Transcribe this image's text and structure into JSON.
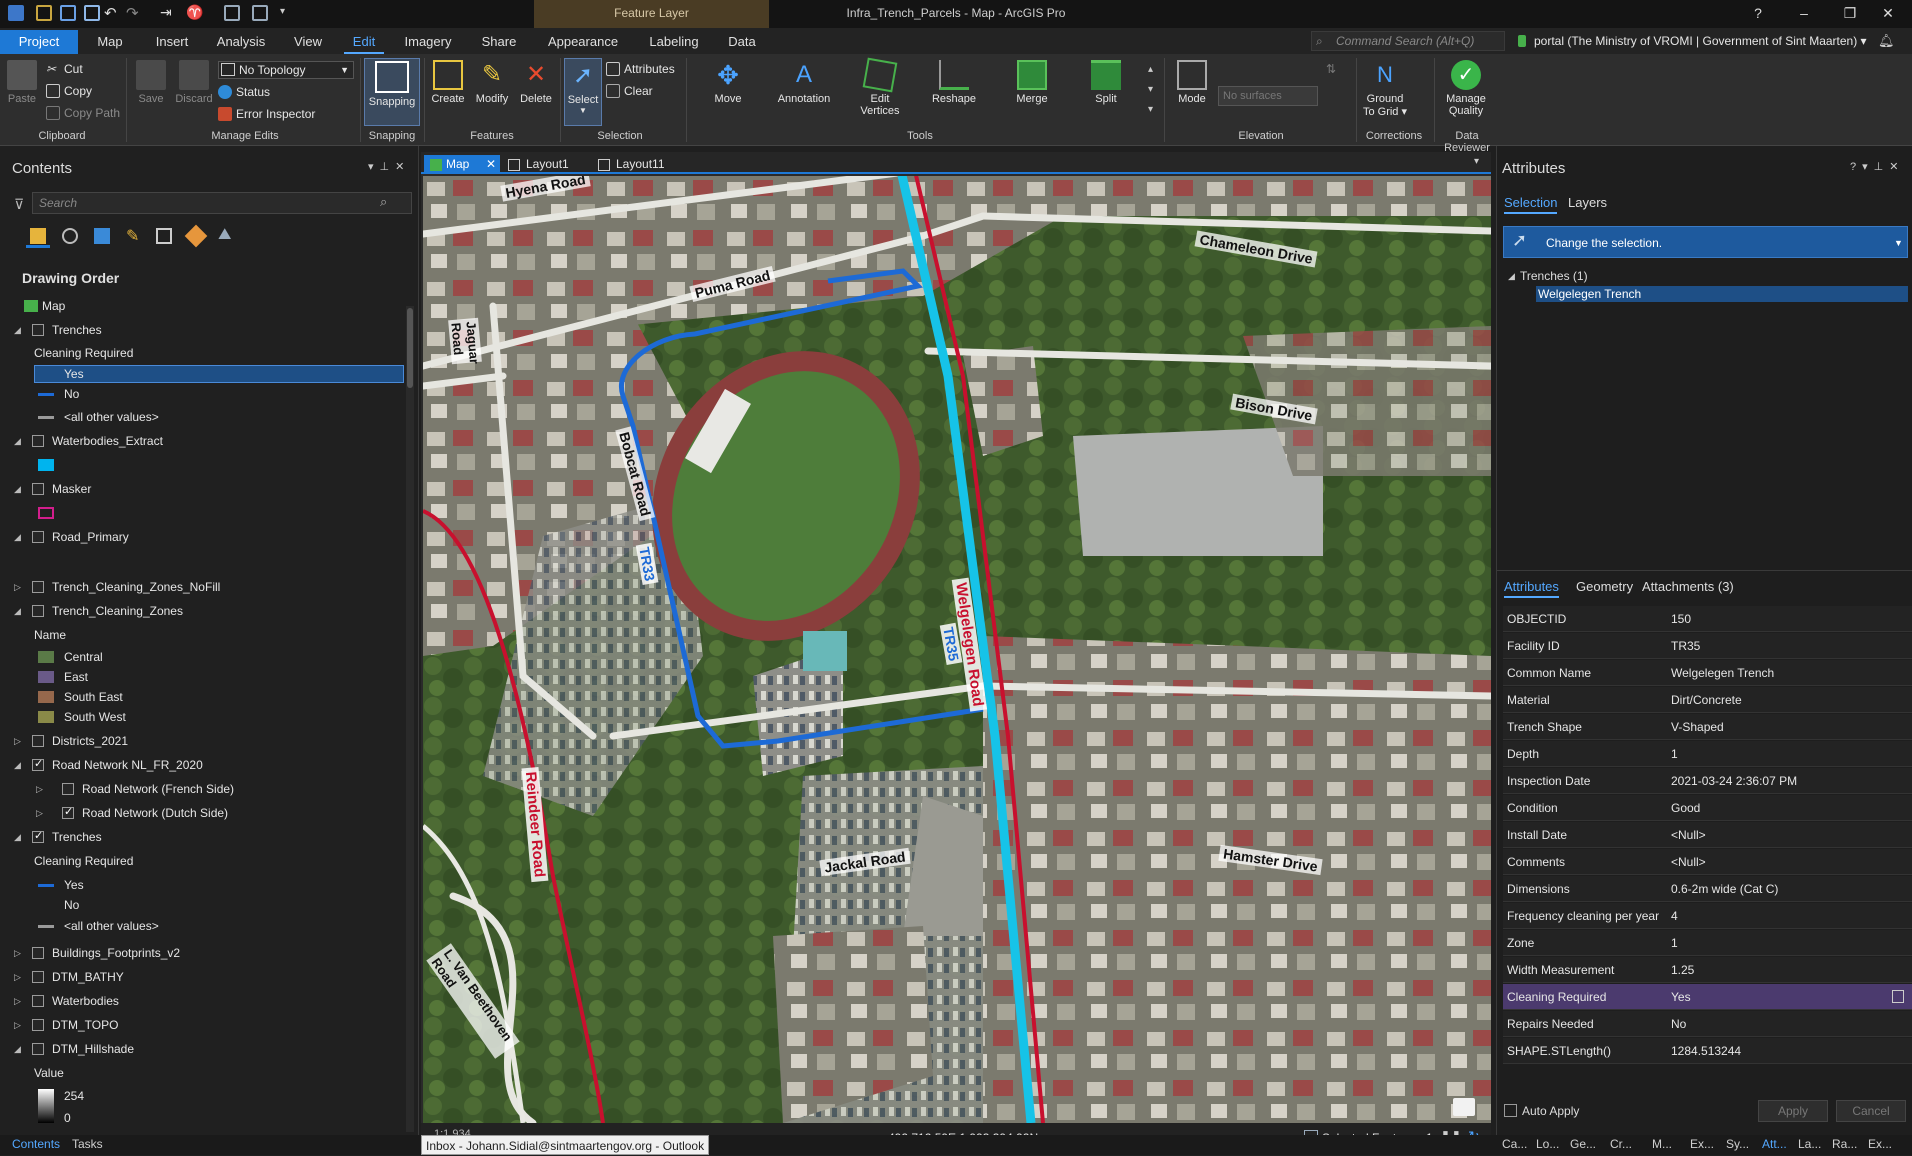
{
  "window": {
    "title": "Infra_Trench_Parcels - Map - ArcGIS Pro",
    "context_tab": "Feature Layer",
    "help": "?",
    "min": "–",
    "restore": "❐",
    "close": "✕"
  },
  "ribbon_tabs": [
    "Project",
    "Map",
    "Insert",
    "Analysis",
    "View",
    "Edit",
    "Imagery",
    "Share",
    "Appearance",
    "Labeling",
    "Data"
  ],
  "command_search": {
    "placeholder": "Command Search (Alt+Q)"
  },
  "portal": "portal (The Ministry of VROMI | Government of Sint Maarten) ▾",
  "ribbon": {
    "clipboard": {
      "paste": "Paste",
      "cut": "Cut",
      "copy": "Copy",
      "copy_path": "Copy Path",
      "group": "Clipboard"
    },
    "manage_edits": {
      "save": "Save",
      "discard": "Discard",
      "topology": "No Topology",
      "status": "Status",
      "error_inspector": "Error Inspector",
      "group": "Manage Edits"
    },
    "snapping": {
      "label": "Snapping",
      "group": "Snapping"
    },
    "features": {
      "create": "Create",
      "modify": "Modify",
      "delete": "Delete",
      "group": "Features"
    },
    "selection": {
      "select": "Select",
      "attributes": "Attributes",
      "clear": "Clear",
      "group": "Selection"
    },
    "tools": {
      "move": "Move",
      "annotation": "Annotation",
      "edit_vertices": "Edit Vertices",
      "reshape": "Reshape",
      "merge": "Merge",
      "split": "Split",
      "group": "Tools"
    },
    "elevation": {
      "mode": "Mode",
      "surfaces_placeholder": "No surfaces",
      "group": "Elevation"
    },
    "corrections": {
      "ground_to_grid": "Ground To Grid ▾",
      "group": "Corrections"
    },
    "data_reviewer": {
      "manage_quality": "Manage Quality",
      "group": "Data Reviewer"
    }
  },
  "contents": {
    "title": "Contents",
    "search_placeholder": "Search",
    "drawing_order": "Drawing Order",
    "items": [
      {
        "label": "Map",
        "level": 0,
        "type": "map"
      },
      {
        "label": "Trenches",
        "level": 1,
        "checked": false
      },
      {
        "label": "Cleaning Required",
        "level": 2,
        "type": "heading"
      },
      {
        "label": "Yes",
        "level": 2,
        "type": "legend",
        "color": "#1d6ad6",
        "selected": true
      },
      {
        "label": "No",
        "level": 2,
        "type": "legend",
        "color": "#1d6ad6"
      },
      {
        "label": "<all other values>",
        "level": 2,
        "type": "legend",
        "color": "#9a9a9a"
      },
      {
        "label": "Waterbodies_Extract",
        "level": 1,
        "checked": false
      },
      {
        "label": "",
        "level": 2,
        "type": "fill",
        "color": "#00b4ee"
      },
      {
        "label": "Masker",
        "level": 1,
        "checked": false
      },
      {
        "label": "",
        "level": 2,
        "type": "outline",
        "color": "#d21e8c"
      },
      {
        "label": "Road_Primary",
        "level": 1,
        "checked": false
      },
      {
        "label": "Trench_Cleaning_Zones_NoFill",
        "level": 1,
        "checked": false,
        "collapsed": true
      },
      {
        "label": "Trench_Cleaning_Zones",
        "level": 1,
        "checked": false
      },
      {
        "label": "Name",
        "level": 2,
        "type": "heading"
      },
      {
        "label": "Central",
        "level": 2,
        "type": "fill",
        "color": "#5a7a47"
      },
      {
        "label": "East",
        "level": 2,
        "type": "fill",
        "color": "#6a5a88"
      },
      {
        "label": "South East",
        "level": 2,
        "type": "fill",
        "color": "#96684c"
      },
      {
        "label": "South West",
        "level": 2,
        "type": "fill",
        "color": "#8a8a48"
      },
      {
        "label": "Districts_2021",
        "level": 1,
        "checked": false,
        "collapsed": true
      },
      {
        "label": "Road Network NL_FR_2020",
        "level": 1,
        "checked": true
      },
      {
        "label": "Road Network (French Side)",
        "level": 2,
        "checked": false,
        "collapsed": true
      },
      {
        "label": "Road Network (Dutch Side)",
        "level": 2,
        "checked": true,
        "collapsed": true
      },
      {
        "label": "Trenches",
        "level": 1,
        "checked": true
      },
      {
        "label": "Cleaning Required",
        "level": 2,
        "type": "heading"
      },
      {
        "label": "Yes",
        "level": 2,
        "type": "legend",
        "color": "#1d6ad6"
      },
      {
        "label": "No",
        "level": 2,
        "type": "legend",
        "color": "#202020"
      },
      {
        "label": "<all other values>",
        "level": 2,
        "type": "legend",
        "color": "#9a9a9a"
      },
      {
        "label": "Buildings_Footprints_v2",
        "level": 1,
        "checked": false,
        "collapsed": true
      },
      {
        "label": "DTM_BATHY",
        "level": 1,
        "checked": false,
        "collapsed": true
      },
      {
        "label": "Waterbodies",
        "level": 1,
        "checked": false,
        "collapsed": true
      },
      {
        "label": "DTM_TOPO",
        "level": 1,
        "checked": false,
        "collapsed": true
      },
      {
        "label": "DTM_Hillshade",
        "level": 1,
        "checked": false
      },
      {
        "label": "Value",
        "level": 2,
        "type": "heading"
      },
      {
        "label": "254",
        "level": 2,
        "type": "ramp"
      },
      {
        "label": "0",
        "level": 2,
        "type": "ramp-end"
      }
    ],
    "bottom_tabs": [
      "Contents",
      "Tasks"
    ]
  },
  "map": {
    "tabs": [
      "Map",
      "Layout1",
      "Layout11"
    ],
    "roads": {
      "hyena": "Hyena Road",
      "puma": "Puma Road",
      "jaguar": "Jaguar Road",
      "chameleon": "Chameleon Drive",
      "bison": "Bison Drive",
      "bobcat": "Bobcat Road",
      "welgelegen": "Welgelegen Road",
      "reindeer": "Reindeer Road",
      "jackal": "Jackal Road",
      "hamster": "Hamster Drive",
      "beethoven": "L. Van Beethoven Road"
    },
    "trench_labels": {
      "tr33": "TR33",
      "tr35": "TR35"
    },
    "coords": "492,712.59E 1,993,394.92N m ▾",
    "selected_features": "Selected Features: 1",
    "scale": "1:1,934"
  },
  "attributes": {
    "title": "Attributes",
    "tabs": [
      "Selection",
      "Layers"
    ],
    "change_selection": "Change the selection.",
    "tree": {
      "layer": "Trenches (1)",
      "feature": "Welgelegen Trench"
    },
    "sub_tabs": [
      "Attributes",
      "Geometry",
      "Attachments (3)"
    ],
    "rows": [
      {
        "k": "OBJECTID",
        "v": "150"
      },
      {
        "k": "Facility ID",
        "v": "TR35"
      },
      {
        "k": "Common Name",
        "v": "Welgelegen Trench"
      },
      {
        "k": "Material",
        "v": "Dirt/Concrete"
      },
      {
        "k": "Trench Shape",
        "v": "V-Shaped"
      },
      {
        "k": "Depth",
        "v": "1"
      },
      {
        "k": "Inspection Date",
        "v": "2021-03-24 2:36:07 PM"
      },
      {
        "k": "Condition",
        "v": "Good"
      },
      {
        "k": "Install Date",
        "v": "<Null>"
      },
      {
        "k": "Comments",
        "v": "<Null>"
      },
      {
        "k": "Dimensions",
        "v": "0.6-2m wide (Cat C)"
      },
      {
        "k": "Frequency cleaning per year",
        "v": "4"
      },
      {
        "k": "Zone",
        "v": "1"
      },
      {
        "k": "Width Measurement",
        "v": "1.25"
      },
      {
        "k": "Cleaning Required",
        "v": "Yes",
        "highlight": true
      },
      {
        "k": "Repairs Needed",
        "v": "No"
      },
      {
        "k": "SHAPE.STLength()",
        "v": "1284.513244"
      }
    ],
    "auto_apply": "Auto Apply",
    "apply": "Apply",
    "cancel": "Cancel",
    "bottom_tabs": [
      "Ca...",
      "Lo...",
      "Ge...",
      "Cr...",
      "M...",
      "Ex...",
      "Sy...",
      "Att...",
      "La...",
      "Ra...",
      "Ex..."
    ]
  },
  "taskbar_tooltip": "Inbox - Johann.Sidial@sintmaartengov.org - Outlook",
  "colors": {
    "accent": "#1e79d6",
    "trench_cyan": "#16c3e8",
    "road_red": "#c8102e",
    "highlight_row": "#4b3a6e"
  }
}
